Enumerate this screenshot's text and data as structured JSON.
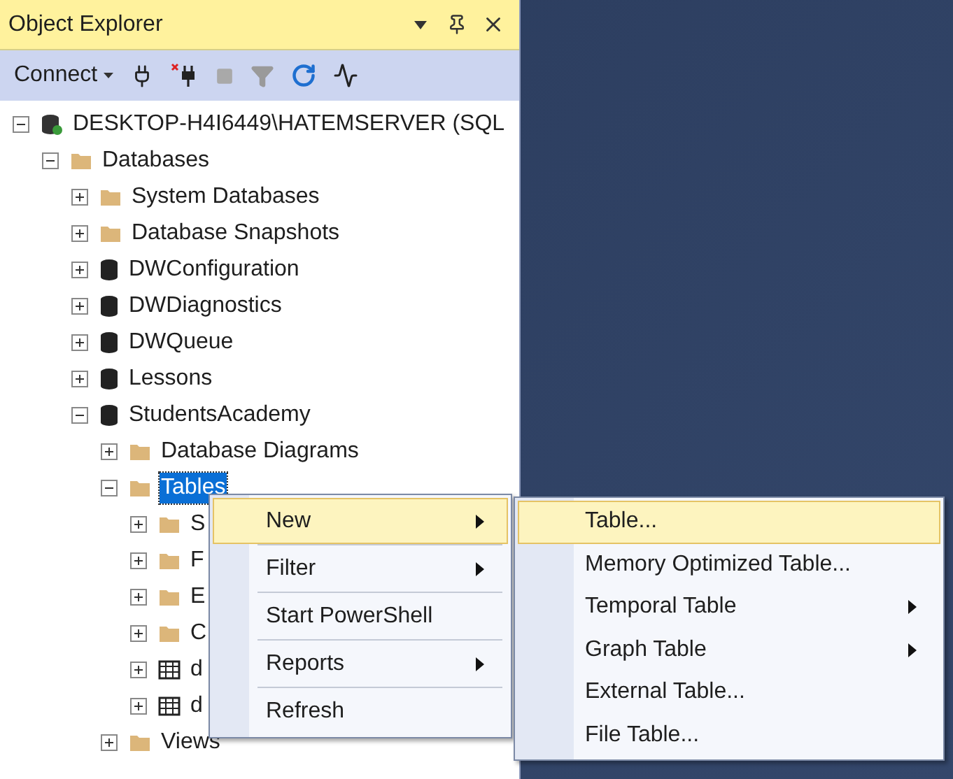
{
  "panel": {
    "title": "Object Explorer"
  },
  "toolbar": {
    "connect_label": "Connect"
  },
  "tree": [
    {
      "label": "DESKTOP-H4I6449\\HATEMSERVER (SQL",
      "kind": "server",
      "expanded": true,
      "selected": false,
      "children": [
        {
          "label": "Databases",
          "kind": "folder",
          "expanded": true,
          "selected": false,
          "children": [
            {
              "label": "System Databases",
              "kind": "folder",
              "expanded": false,
              "selected": false
            },
            {
              "label": "Database Snapshots",
              "kind": "folder",
              "expanded": false,
              "selected": false
            },
            {
              "label": "DWConfiguration",
              "kind": "database",
              "expanded": false,
              "selected": false
            },
            {
              "label": "DWDiagnostics",
              "kind": "database",
              "expanded": false,
              "selected": false
            },
            {
              "label": "DWQueue",
              "kind": "database",
              "expanded": false,
              "selected": false
            },
            {
              "label": "Lessons",
              "kind": "database",
              "expanded": false,
              "selected": false
            },
            {
              "label": "StudentsAcademy",
              "kind": "database",
              "expanded": true,
              "selected": false,
              "children": [
                {
                  "label": "Database Diagrams",
                  "kind": "folder",
                  "expanded": false,
                  "selected": false
                },
                {
                  "label": "Tables",
                  "kind": "folder",
                  "expanded": true,
                  "selected": true,
                  "children": [
                    {
                      "label": "S",
                      "kind": "folder",
                      "expanded": false,
                      "selected": false
                    },
                    {
                      "label": "F",
                      "kind": "folder",
                      "expanded": false,
                      "selected": false
                    },
                    {
                      "label": "E",
                      "kind": "folder",
                      "expanded": false,
                      "selected": false
                    },
                    {
                      "label": "C",
                      "kind": "folder",
                      "expanded": false,
                      "selected": false
                    },
                    {
                      "label": "d",
                      "kind": "table",
                      "expanded": false,
                      "selected": false
                    },
                    {
                      "label": "d",
                      "kind": "table",
                      "expanded": false,
                      "selected": false
                    }
                  ]
                },
                {
                  "label": "Views",
                  "kind": "folder",
                  "expanded": false,
                  "selected": false
                }
              ]
            }
          ]
        }
      ]
    }
  ],
  "context_menu": {
    "items": [
      {
        "label": "New",
        "submenu": true,
        "selected": true
      },
      {
        "label": "Filter",
        "submenu": true,
        "selected": false
      },
      {
        "label": "Start PowerShell",
        "submenu": false,
        "selected": false
      },
      {
        "label": "Reports",
        "submenu": true,
        "selected": false
      },
      {
        "label": "Refresh",
        "submenu": false,
        "selected": false
      }
    ]
  },
  "submenu": {
    "items": [
      {
        "label": "Table...",
        "submenu": false,
        "selected": true
      },
      {
        "label": "Memory Optimized Table...",
        "submenu": false,
        "selected": false
      },
      {
        "label": "Temporal Table",
        "submenu": true,
        "selected": false
      },
      {
        "label": "Graph Table",
        "submenu": true,
        "selected": false
      },
      {
        "label": "External Table...",
        "submenu": false,
        "selected": false
      },
      {
        "label": "File Table...",
        "submenu": false,
        "selected": false
      }
    ]
  }
}
